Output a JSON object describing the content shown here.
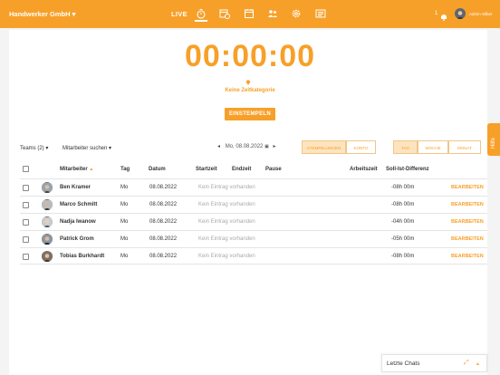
{
  "topbar": {
    "company": "Handwerker GmbH",
    "company_caret": "▾",
    "live_label": "LIVE",
    "nav_icons": [
      "stopwatch-icon",
      "calendar-clock-icon",
      "calendar-icon",
      "team-icon",
      "gear-icon",
      "news-icon"
    ],
    "notification_count": "1",
    "user_name": "Admin Silber",
    "color": "#f7a029"
  },
  "timer": {
    "display": "00:00:00",
    "category": "Keine Zeitkategorie",
    "stamp_in": "EINSTEMPELN"
  },
  "help_tab": "Hilfe",
  "filters": {
    "teams": "Teams (2)",
    "employee_search": "Mitarbeiter suchen",
    "date": "Mo, 08.08.2022",
    "prev": "◂",
    "next": "▸",
    "view_toggle": [
      "STEMPELUNGEN",
      "KONTO"
    ],
    "range_toggle": [
      "TAG",
      "WOCHE",
      "MONAT"
    ]
  },
  "table": {
    "headers": {
      "employee": "Mitarbeiter",
      "day": "Tag",
      "date": "Datum",
      "start": "Startzeit",
      "end": "Endzeit",
      "pause": "Pause",
      "worktime": "Arbeitszeit",
      "diff": "Soll-Ist-Differenz"
    },
    "rows": [
      {
        "name": "Ben Kramer",
        "day": "Mo",
        "date": "08.08.2022",
        "entry": "Kein Eintrag vorhanden",
        "diff": "-08h 00m",
        "action": "BEARBEITEN"
      },
      {
        "name": "Marco Schmitt",
        "day": "Mo",
        "date": "08.08.2022",
        "entry": "Kein Eintrag vorhanden",
        "diff": "-08h 00m",
        "action": "BEARBEITEN"
      },
      {
        "name": "Nadja Iwanow",
        "day": "Mo",
        "date": "08.08.2022",
        "entry": "Kein Eintrag vorhanden",
        "diff": "-04h 00m",
        "action": "BEARBEITEN"
      },
      {
        "name": "Patrick Grom",
        "day": "Mo",
        "date": "08.08.2022",
        "entry": "Kein Eintrag vorhanden",
        "diff": "-05h 00m",
        "action": "BEARBEITEN"
      },
      {
        "name": "Tobias Burkhardt",
        "day": "Mo",
        "date": "08.08.2022",
        "entry": "Kein Eintrag vorhanden",
        "diff": "-08h 00m",
        "action": "BEARBEITEN"
      }
    ]
  },
  "chat": {
    "title": "Letzte Chats"
  }
}
